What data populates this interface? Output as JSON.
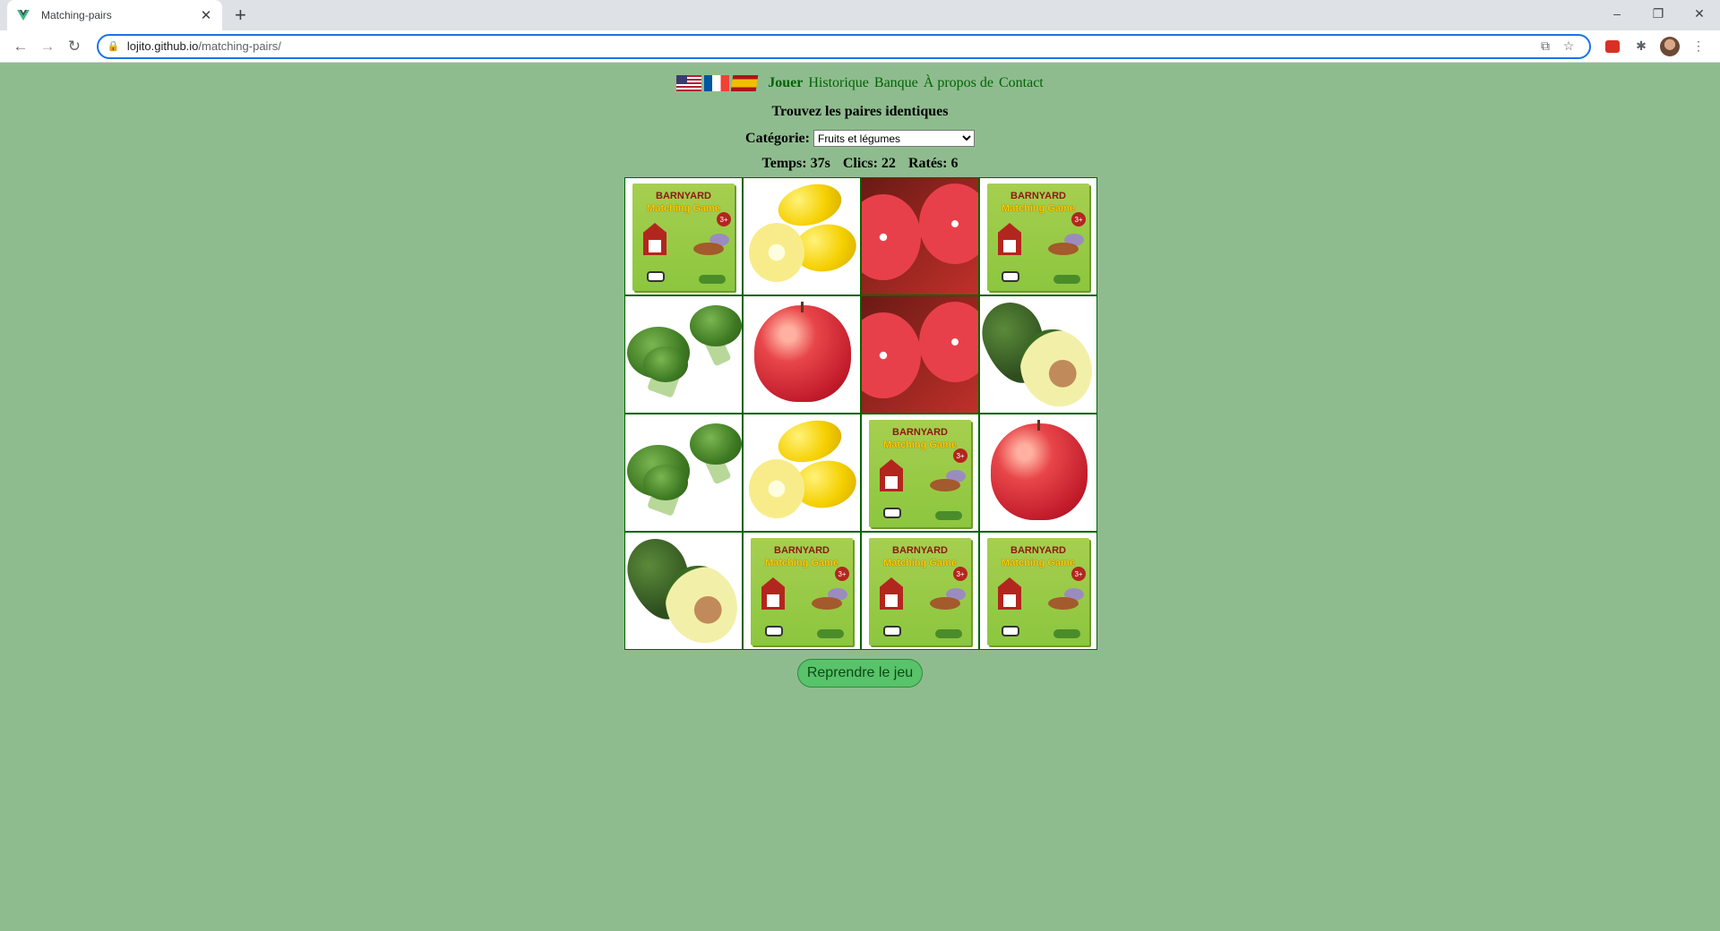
{
  "browser": {
    "tab_title": "Matching-pairs",
    "tab_close": "✕",
    "new_tab": "+",
    "url_host": "lojito.github.io",
    "url_path": "/matching-pairs/",
    "window_controls": [
      "–",
      "❐",
      "✕"
    ]
  },
  "nav": {
    "flags": [
      "flag-us-icon",
      "flag-fr-icon",
      "flag-es-icon"
    ],
    "links": [
      "Jouer",
      "Historique",
      "Banque",
      "À propos de",
      "Contact"
    ],
    "active": "Jouer"
  },
  "game": {
    "heading": "Trouvez les paires identiques",
    "category_label": "Catégorie:",
    "category_value": "Fruits et légumes",
    "stats": {
      "time": "Temps: 37s",
      "clicks": "Clics: 22",
      "misses": "Ratés: 6"
    },
    "grid": [
      [
        "back",
        "lemon",
        "grapefruit",
        "back"
      ],
      [
        "broccoli",
        "apple",
        "grapefruit",
        "avocado"
      ],
      [
        "broccoli",
        "lemon",
        "back",
        "apple"
      ],
      [
        "avocado",
        "back",
        "back",
        "back"
      ]
    ],
    "back_text": [
      "BARNYARD",
      "Matching Game"
    ],
    "resume_label": "Reprendre le jeu"
  },
  "colors": {
    "page_bg": "#8fbc8f",
    "link_green": "#006400",
    "button_green": "#58c36a"
  }
}
